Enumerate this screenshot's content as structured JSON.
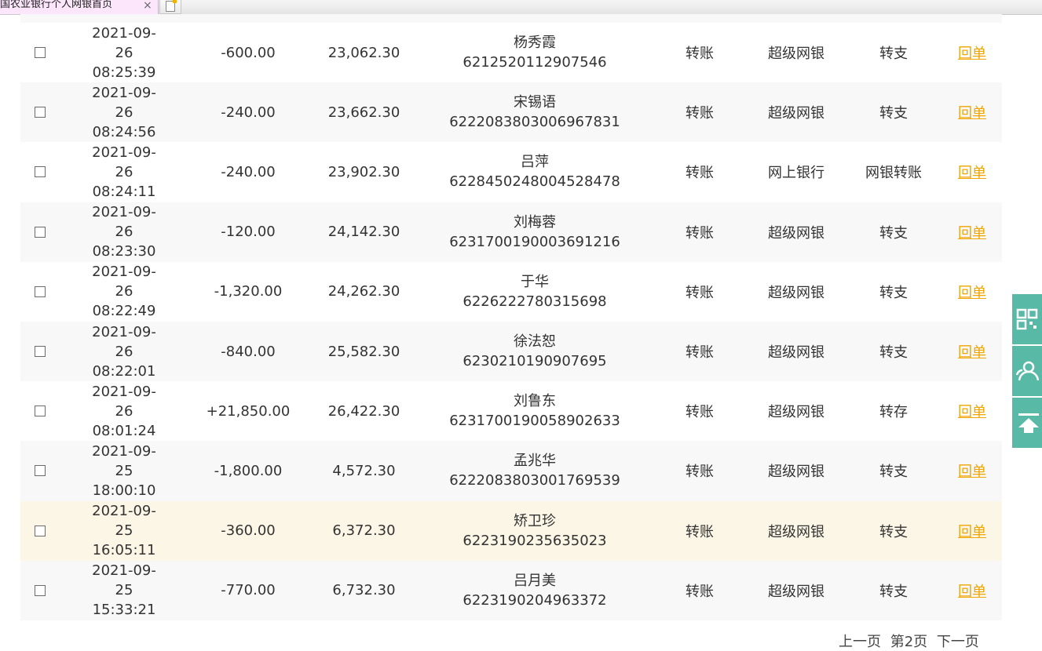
{
  "browser": {
    "tab_title": "国农业银行个人网银首页",
    "tab_close": "×"
  },
  "transactions": [
    {
      "date": "2021-09-26",
      "time": "08:25:39",
      "amount": "-600.00",
      "balance": "23,062.30",
      "name": "杨秀霞",
      "account": "6212520112907546",
      "type": "转账",
      "channel": "超级网银",
      "summary": "转支",
      "receipt": "回单"
    },
    {
      "date": "2021-09-26",
      "time": "08:24:56",
      "amount": "-240.00",
      "balance": "23,662.30",
      "name": "宋锡语",
      "account": "6222083803006967831",
      "type": "转账",
      "channel": "超级网银",
      "summary": "转支",
      "receipt": "回单"
    },
    {
      "date": "2021-09-26",
      "time": "08:24:11",
      "amount": "-240.00",
      "balance": "23,902.30",
      "name": "吕萍",
      "account": "6228450248004528478",
      "type": "转账",
      "channel": "网上银行",
      "summary": "网银转账",
      "receipt": "回单"
    },
    {
      "date": "2021-09-26",
      "time": "08:23:30",
      "amount": "-120.00",
      "balance": "24,142.30",
      "name": "刘梅蓉",
      "account": "6231700190003691216",
      "type": "转账",
      "channel": "超级网银",
      "summary": "转支",
      "receipt": "回单"
    },
    {
      "date": "2021-09-26",
      "time": "08:22:49",
      "amount": "-1,320.00",
      "balance": "24,262.30",
      "name": "于华",
      "account": "6226222780315698",
      "type": "转账",
      "channel": "超级网银",
      "summary": "转支",
      "receipt": "回单"
    },
    {
      "date": "2021-09-26",
      "time": "08:22:01",
      "amount": "-840.00",
      "balance": "25,582.30",
      "name": "徐法恕",
      "account": "6230210190907695",
      "type": "转账",
      "channel": "超级网银",
      "summary": "转支",
      "receipt": "回单"
    },
    {
      "date": "2021-09-26",
      "time": "08:01:24",
      "amount": "+21,850.00",
      "balance": "26,422.30",
      "name": "刘鲁东",
      "account": "6231700190058902633",
      "type": "转账",
      "channel": "超级网银",
      "summary": "转存",
      "receipt": "回单"
    },
    {
      "date": "2021-09-25",
      "time": "18:00:10",
      "amount": "-1,800.00",
      "balance": "4,572.30",
      "name": "孟兆华",
      "account": "6222083803001769539",
      "type": "转账",
      "channel": "超级网银",
      "summary": "转支",
      "receipt": "回单"
    },
    {
      "date": "2021-09-25",
      "time": "16:05:11",
      "amount": "-360.00",
      "balance": "6,372.30",
      "name": "矫卫珍",
      "account": "6223190235635023",
      "type": "转账",
      "channel": "超级网银",
      "summary": "转支",
      "receipt": "回单"
    },
    {
      "date": "2021-09-25",
      "time": "15:33:21",
      "amount": "-770.00",
      "balance": "6,732.30",
      "name": "吕月美",
      "account": "6223190204963372",
      "type": "转账",
      "channel": "超级网银",
      "summary": "转支",
      "receipt": "回单"
    }
  ],
  "pager": {
    "prev_label": "上一页",
    "current_label": "第2页",
    "next_label": "下一页"
  },
  "colors": {
    "receipt_link": "#f0a500",
    "float_tool_bg": "#57b9a6",
    "row_highlight": "#fcf6e6"
  },
  "float_tools": [
    {
      "icon": "qr-code-icon"
    },
    {
      "icon": "customer-service-icon"
    },
    {
      "icon": "back-to-top-icon"
    }
  ]
}
